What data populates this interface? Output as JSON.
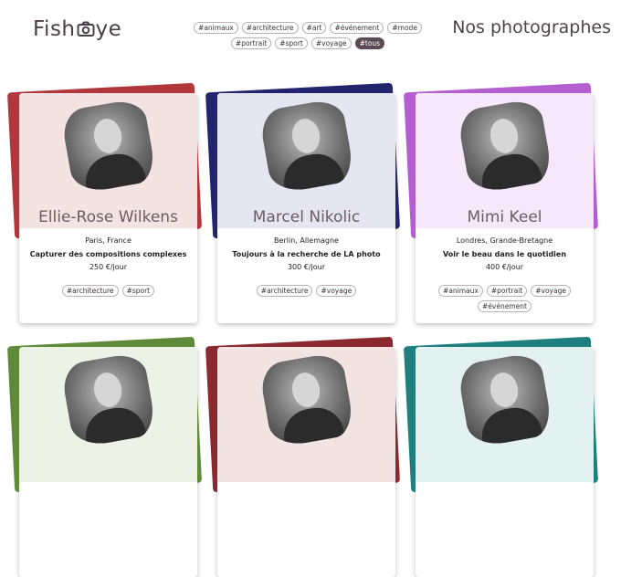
{
  "header": {
    "logo_text_left": "Fish",
    "logo_text_right": "ye",
    "page_title": "Nos photographes",
    "tags": [
      {
        "label": "#animaux",
        "active": false
      },
      {
        "label": "#architecture",
        "active": false
      },
      {
        "label": "#art",
        "active": false
      },
      {
        "label": "#événement",
        "active": false
      },
      {
        "label": "#mode",
        "active": false
      },
      {
        "label": "#portrait",
        "active": false
      },
      {
        "label": "#sport",
        "active": false
      },
      {
        "label": "#voyage",
        "active": false
      },
      {
        "label": "#tous",
        "active": true
      }
    ]
  },
  "photographers": [
    {
      "name": "Ellie-Rose Wilkens",
      "location": "Paris, France",
      "tagline": "Capturer des compositions complexes",
      "price": "250 €/jour",
      "tags": [
        "#architecture",
        "#sport"
      ],
      "accent": "#b0383c",
      "tint": "#f4e3e3"
    },
    {
      "name": "Marcel Nikolic",
      "location": "Berlin, Allemagne",
      "tagline": "Toujours à la recherche de LA photo",
      "price": "300 €/jour",
      "tags": [
        "#architecture",
        "#voyage"
      ],
      "accent": "#22246e",
      "tint": "#e6e6f2"
    },
    {
      "name": "Mimi Keel",
      "location": "Londres, Grande-Bretagne",
      "tagline": "Voir le beau dans le quotidien",
      "price": "400 €/jour",
      "tags": [
        "#animaux",
        "#portrait",
        "#voyage",
        "#événement"
      ],
      "accent": "#b35fd0",
      "tint": "#f6e8fa"
    },
    {
      "accent": "#5f8a3a",
      "tint": "#edf2e6"
    },
    {
      "accent": "#8a2a2e",
      "tint": "#f3e4e4"
    },
    {
      "accent": "#1f7f7f",
      "tint": "#e4f1f1"
    }
  ]
}
